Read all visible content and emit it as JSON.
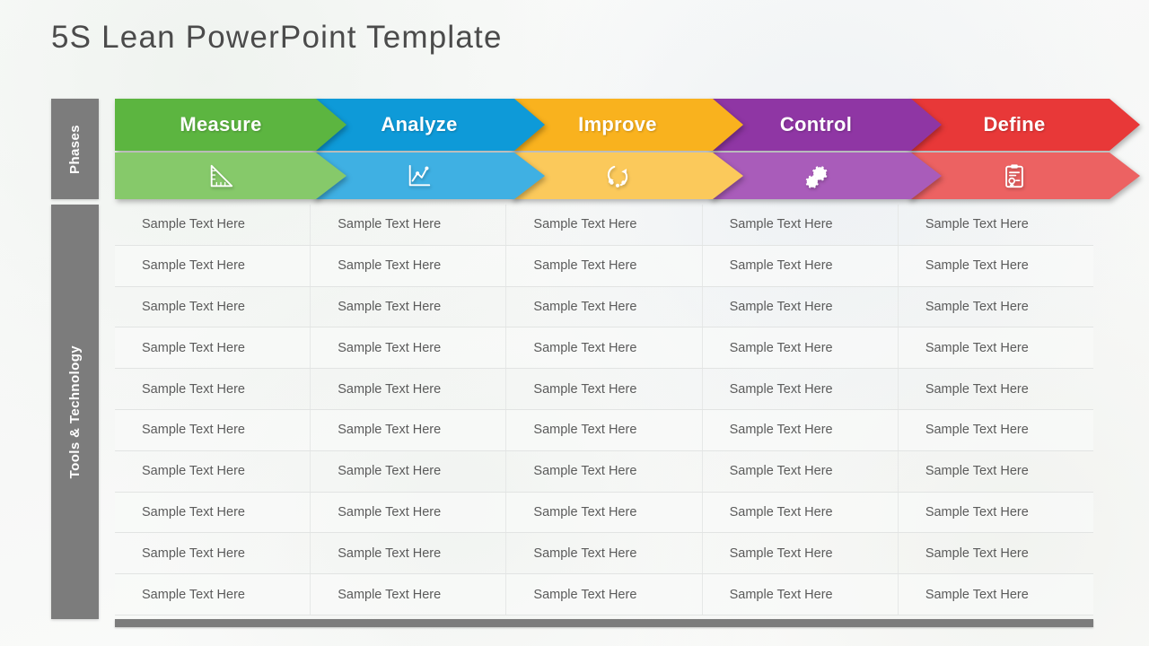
{
  "slide": {
    "title": "5S Lean PowerPoint Template",
    "background_color": "#fafbfa",
    "title_color": "#4b4b4b"
  },
  "side_labels": {
    "phases": "Phases",
    "tools": "Tools & Technology",
    "bar_color": "#7c7c7c"
  },
  "phases": [
    {
      "label": "Measure",
      "icon": "triangle-ruler-icon",
      "color_top": "#5cb540",
      "color_bottom": "#86c96a"
    },
    {
      "label": "Analyze",
      "icon": "line-chart-icon",
      "color_top": "#0e9ad8",
      "color_bottom": "#3fb0e3"
    },
    {
      "label": "Improve",
      "icon": "cycle-arrows-icon",
      "color_top": "#f9b21e",
      "color_bottom": "#fbc95b"
    },
    {
      "label": "Control",
      "icon": "gears-icon",
      "color_top": "#8f36a4",
      "color_bottom": "#a95cba"
    },
    {
      "label": "Define",
      "icon": "clipboard-checklist-icon",
      "color_top": "#e83838",
      "color_bottom": "#ec6262"
    }
  ],
  "table": {
    "row_count": 10,
    "column_count": 5,
    "rows": [
      [
        "Sample Text Here",
        "Sample Text Here",
        "Sample Text Here",
        "Sample Text Here",
        "Sample Text Here"
      ],
      [
        "Sample Text Here",
        "Sample Text Here",
        "Sample Text Here",
        "Sample Text Here",
        "Sample Text Here"
      ],
      [
        "Sample Text Here",
        "Sample Text Here",
        "Sample Text Here",
        "Sample Text Here",
        "Sample Text Here"
      ],
      [
        "Sample Text Here",
        "Sample Text Here",
        "Sample Text Here",
        "Sample Text Here",
        "Sample Text Here"
      ],
      [
        "Sample Text Here",
        "Sample Text Here",
        "Sample Text Here",
        "Sample Text Here",
        "Sample Text Here"
      ],
      [
        "Sample Text Here",
        "Sample Text Here",
        "Sample Text Here",
        "Sample Text Here",
        "Sample Text Here"
      ],
      [
        "Sample Text Here",
        "Sample Text Here",
        "Sample Text Here",
        "Sample Text Here",
        "Sample Text Here"
      ],
      [
        "Sample Text Here",
        "Sample Text Here",
        "Sample Text Here",
        "Sample Text Here",
        "Sample Text Here"
      ],
      [
        "Sample Text Here",
        "Sample Text Here",
        "Sample Text Here",
        "Sample Text Here",
        "Sample Text Here"
      ],
      [
        "Sample Text Here",
        "Sample Text Here",
        "Sample Text Here",
        "Sample Text Here",
        "Sample Text Here"
      ]
    ]
  }
}
